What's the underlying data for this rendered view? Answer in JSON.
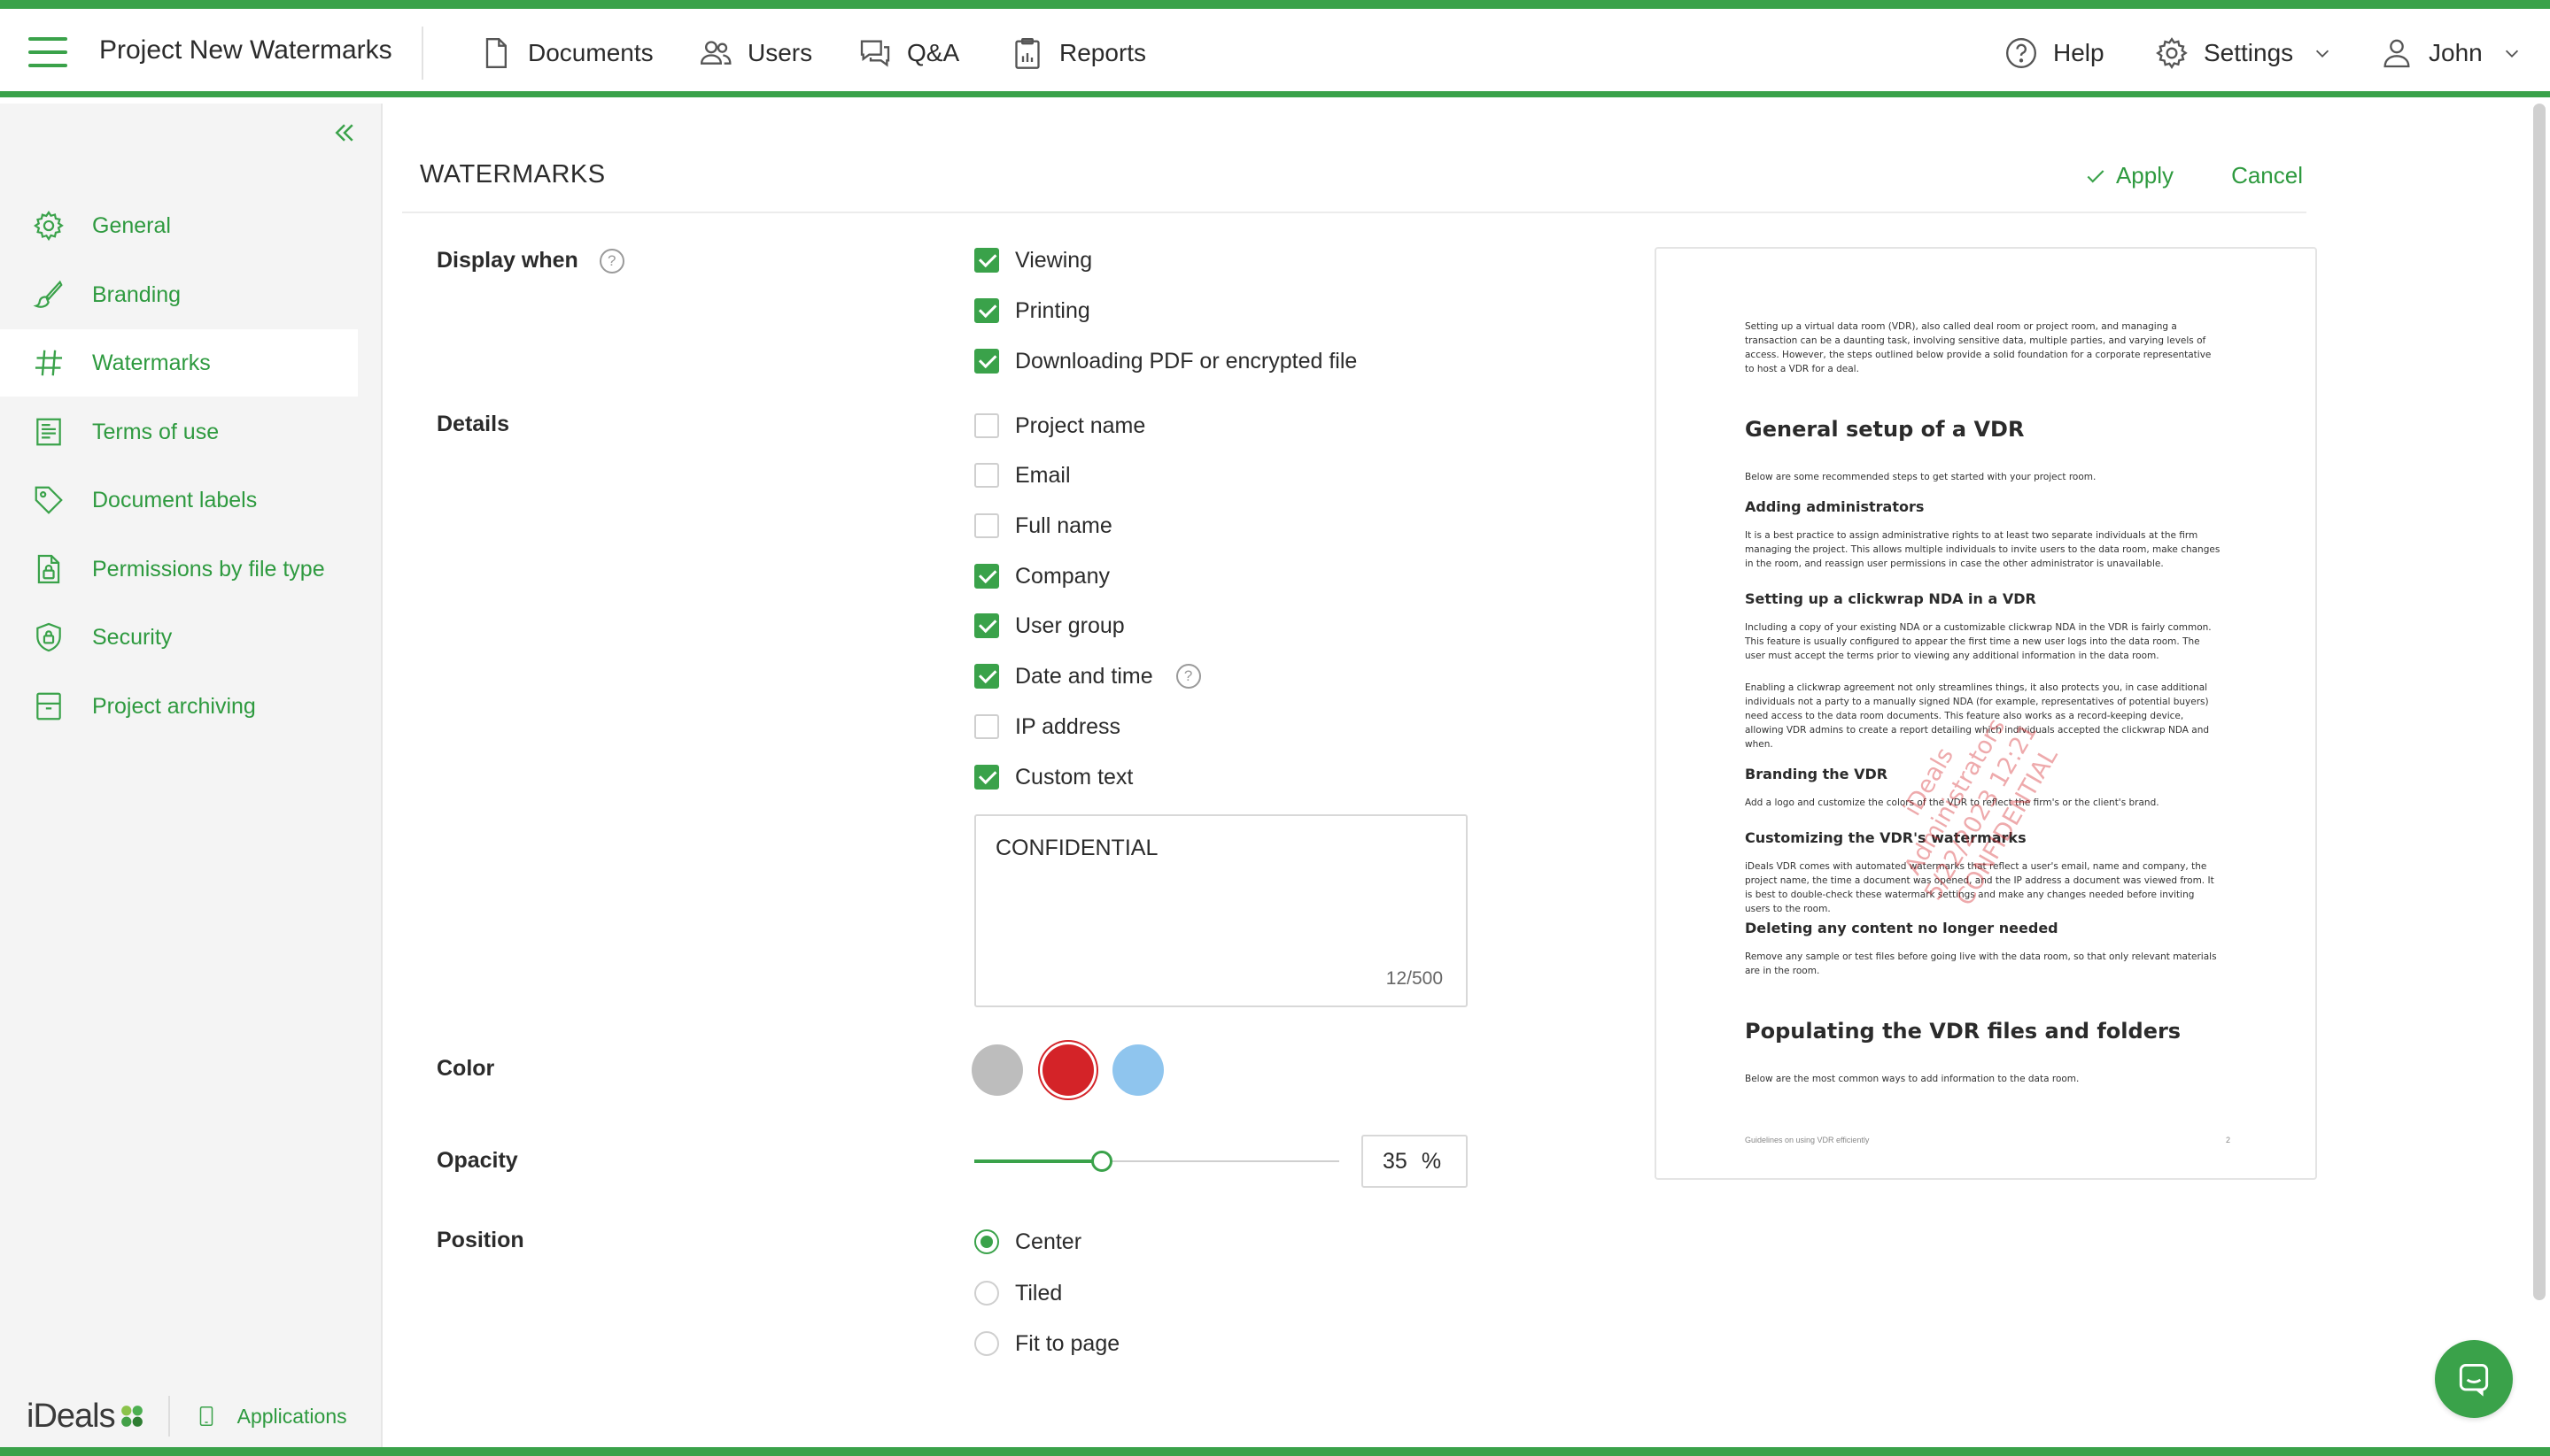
{
  "header": {
    "project_title": "Project New Watermarks",
    "nav": [
      {
        "label": "Documents",
        "icon": "document-icon"
      },
      {
        "label": "Users",
        "icon": "users-icon"
      },
      {
        "label": "Q&A",
        "icon": "chat-icon"
      },
      {
        "label": "Reports",
        "icon": "clipboard-icon"
      }
    ],
    "help_label": "Help",
    "settings_label": "Settings",
    "user_label": "John"
  },
  "sidebar": {
    "items": [
      {
        "label": "General",
        "icon": "gear-icon"
      },
      {
        "label": "Branding",
        "icon": "brush-icon"
      },
      {
        "label": "Watermarks",
        "icon": "hash-icon"
      },
      {
        "label": "Terms of use",
        "icon": "terms-icon"
      },
      {
        "label": "Document labels",
        "icon": "tag-icon"
      },
      {
        "label": "Permissions by file type",
        "icon": "file-lock-icon"
      },
      {
        "label": "Security",
        "icon": "shield-lock-icon"
      },
      {
        "label": "Project archiving",
        "icon": "archive-icon"
      }
    ],
    "logo_text": "iDeals",
    "applications_label": "Applications"
  },
  "page": {
    "title": "WATERMARKS",
    "apply_label": "Apply",
    "cancel_label": "Cancel"
  },
  "display_when": {
    "label": "Display when",
    "options": [
      {
        "label": "Viewing",
        "checked": true
      },
      {
        "label": "Printing",
        "checked": true
      },
      {
        "label": "Downloading PDF or encrypted file",
        "checked": true
      }
    ]
  },
  "details": {
    "label": "Details",
    "options": [
      {
        "label": "Project name",
        "checked": false
      },
      {
        "label": "Email",
        "checked": false
      },
      {
        "label": "Full name",
        "checked": false
      },
      {
        "label": "Company",
        "checked": true
      },
      {
        "label": "User group",
        "checked": true
      },
      {
        "label": "Date and time",
        "checked": true
      },
      {
        "label": "IP address",
        "checked": false
      },
      {
        "label": "Custom text",
        "checked": true
      }
    ],
    "custom_text_value": "CONFIDENTIAL",
    "custom_text_counter": "12/500"
  },
  "color": {
    "label": "Color",
    "swatches": [
      "#bdbdbd",
      "#d42328",
      "#8fc5ee"
    ],
    "selected": "#d42328"
  },
  "opacity": {
    "label": "Opacity",
    "value": "35",
    "unit": "%"
  },
  "position": {
    "label": "Position",
    "options": [
      {
        "label": "Center",
        "selected": true
      },
      {
        "label": "Tiled",
        "selected": false
      },
      {
        "label": "Fit to page",
        "selected": false
      }
    ]
  },
  "preview": {
    "intro": "Setting up a virtual data room (VDR), also called deal room or project room, and managing a transaction can be a daunting task, involving sensitive data, multiple parties, and varying levels of access. However, the steps outlined below provide a solid foundation for a corporate representative to host a VDR for a deal.",
    "h1_setup": "General setup of a VDR",
    "setup_intro": "Below are some recommended steps to get started with your project room.",
    "h_admins": "Adding administrators",
    "admins_text": "It is a best practice to assign administrative rights to at least two separate individuals at the firm managing the project. This allows multiple individuals to invite users to the data room, make changes in the room, and reassign user permissions in case the other administrator is unavailable.",
    "h_nda": "Setting up a clickwrap NDA in a VDR",
    "nda_text1": "Including a copy of your existing NDA or a customizable clickwrap NDA in the VDR is fairly common. This feature is usually configured to appear the first time a new user logs into the data room. The user must accept the terms prior to viewing any additional information in the data room.",
    "nda_text2": "Enabling a clickwrap agreement not only streamlines things, it also protects you, in case additional individuals not a party to a manually signed NDA (for example, representatives of potential buyers) need access to the data room documents. This feature also works as a record-keeping device, allowing VDR admins to create a report detailing which individuals accepted the clickwrap NDA and when.",
    "h_branding": "Branding the VDR",
    "branding_text": "Add a logo and customize the colors of the VDR to reflect the firm's or the client's brand.",
    "h_watermarks": "Customizing the VDR's watermarks",
    "watermarks_text": "iDeals VDR comes with automated watermarks that reflect a user's email, name and company, the project name, the time a document was opened, and the IP address a document was viewed from. It is best to double-check these watermark settings and make any changes needed before inviting users to the room.",
    "h_delete": "Deleting any content no longer needed",
    "delete_text": "Remove any sample or test files before going live with the data room, so that only relevant materials are in the room.",
    "h1_populating": "Populating the VDR files and folders",
    "populating_text": "Below are the most common ways to add information to the data room.",
    "footer_left": "Guidelines on using VDR efficiently",
    "footer_right": "2",
    "watermark_lines": [
      "iDeals",
      "Administrators",
      "5/22/2023 12:21",
      "CONFIDENTIAL"
    ]
  }
}
